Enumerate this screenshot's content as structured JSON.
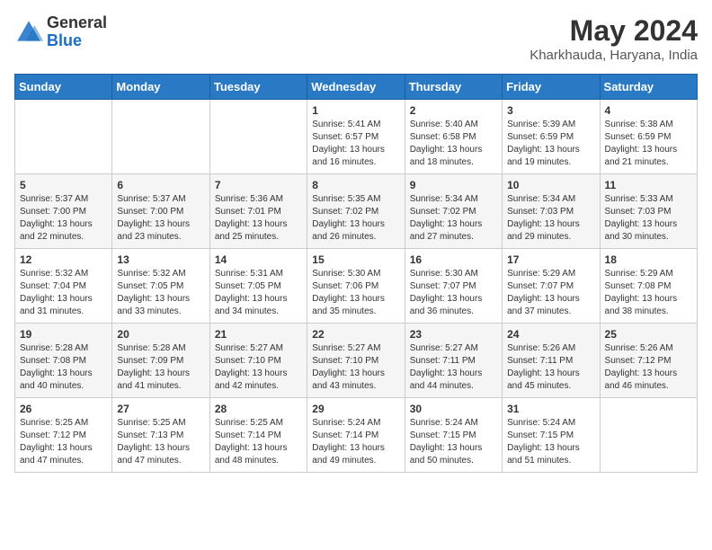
{
  "header": {
    "logo_general": "General",
    "logo_blue": "Blue",
    "month_year": "May 2024",
    "location": "Kharkhauda, Haryana, India"
  },
  "days_of_week": [
    "Sunday",
    "Monday",
    "Tuesday",
    "Wednesday",
    "Thursday",
    "Friday",
    "Saturday"
  ],
  "weeks": [
    [
      {
        "num": "",
        "info": ""
      },
      {
        "num": "",
        "info": ""
      },
      {
        "num": "",
        "info": ""
      },
      {
        "num": "1",
        "info": "Sunrise: 5:41 AM\nSunset: 6:57 PM\nDaylight: 13 hours and 16 minutes."
      },
      {
        "num": "2",
        "info": "Sunrise: 5:40 AM\nSunset: 6:58 PM\nDaylight: 13 hours and 18 minutes."
      },
      {
        "num": "3",
        "info": "Sunrise: 5:39 AM\nSunset: 6:59 PM\nDaylight: 13 hours and 19 minutes."
      },
      {
        "num": "4",
        "info": "Sunrise: 5:38 AM\nSunset: 6:59 PM\nDaylight: 13 hours and 21 minutes."
      }
    ],
    [
      {
        "num": "5",
        "info": "Sunrise: 5:37 AM\nSunset: 7:00 PM\nDaylight: 13 hours and 22 minutes."
      },
      {
        "num": "6",
        "info": "Sunrise: 5:37 AM\nSunset: 7:00 PM\nDaylight: 13 hours and 23 minutes."
      },
      {
        "num": "7",
        "info": "Sunrise: 5:36 AM\nSunset: 7:01 PM\nDaylight: 13 hours and 25 minutes."
      },
      {
        "num": "8",
        "info": "Sunrise: 5:35 AM\nSunset: 7:02 PM\nDaylight: 13 hours and 26 minutes."
      },
      {
        "num": "9",
        "info": "Sunrise: 5:34 AM\nSunset: 7:02 PM\nDaylight: 13 hours and 27 minutes."
      },
      {
        "num": "10",
        "info": "Sunrise: 5:34 AM\nSunset: 7:03 PM\nDaylight: 13 hours and 29 minutes."
      },
      {
        "num": "11",
        "info": "Sunrise: 5:33 AM\nSunset: 7:03 PM\nDaylight: 13 hours and 30 minutes."
      }
    ],
    [
      {
        "num": "12",
        "info": "Sunrise: 5:32 AM\nSunset: 7:04 PM\nDaylight: 13 hours and 31 minutes."
      },
      {
        "num": "13",
        "info": "Sunrise: 5:32 AM\nSunset: 7:05 PM\nDaylight: 13 hours and 33 minutes."
      },
      {
        "num": "14",
        "info": "Sunrise: 5:31 AM\nSunset: 7:05 PM\nDaylight: 13 hours and 34 minutes."
      },
      {
        "num": "15",
        "info": "Sunrise: 5:30 AM\nSunset: 7:06 PM\nDaylight: 13 hours and 35 minutes."
      },
      {
        "num": "16",
        "info": "Sunrise: 5:30 AM\nSunset: 7:07 PM\nDaylight: 13 hours and 36 minutes."
      },
      {
        "num": "17",
        "info": "Sunrise: 5:29 AM\nSunset: 7:07 PM\nDaylight: 13 hours and 37 minutes."
      },
      {
        "num": "18",
        "info": "Sunrise: 5:29 AM\nSunset: 7:08 PM\nDaylight: 13 hours and 38 minutes."
      }
    ],
    [
      {
        "num": "19",
        "info": "Sunrise: 5:28 AM\nSunset: 7:08 PM\nDaylight: 13 hours and 40 minutes."
      },
      {
        "num": "20",
        "info": "Sunrise: 5:28 AM\nSunset: 7:09 PM\nDaylight: 13 hours and 41 minutes."
      },
      {
        "num": "21",
        "info": "Sunrise: 5:27 AM\nSunset: 7:10 PM\nDaylight: 13 hours and 42 minutes."
      },
      {
        "num": "22",
        "info": "Sunrise: 5:27 AM\nSunset: 7:10 PM\nDaylight: 13 hours and 43 minutes."
      },
      {
        "num": "23",
        "info": "Sunrise: 5:27 AM\nSunset: 7:11 PM\nDaylight: 13 hours and 44 minutes."
      },
      {
        "num": "24",
        "info": "Sunrise: 5:26 AM\nSunset: 7:11 PM\nDaylight: 13 hours and 45 minutes."
      },
      {
        "num": "25",
        "info": "Sunrise: 5:26 AM\nSunset: 7:12 PM\nDaylight: 13 hours and 46 minutes."
      }
    ],
    [
      {
        "num": "26",
        "info": "Sunrise: 5:25 AM\nSunset: 7:12 PM\nDaylight: 13 hours and 47 minutes."
      },
      {
        "num": "27",
        "info": "Sunrise: 5:25 AM\nSunset: 7:13 PM\nDaylight: 13 hours and 47 minutes."
      },
      {
        "num": "28",
        "info": "Sunrise: 5:25 AM\nSunset: 7:14 PM\nDaylight: 13 hours and 48 minutes."
      },
      {
        "num": "29",
        "info": "Sunrise: 5:24 AM\nSunset: 7:14 PM\nDaylight: 13 hours and 49 minutes."
      },
      {
        "num": "30",
        "info": "Sunrise: 5:24 AM\nSunset: 7:15 PM\nDaylight: 13 hours and 50 minutes."
      },
      {
        "num": "31",
        "info": "Sunrise: 5:24 AM\nSunset: 7:15 PM\nDaylight: 13 hours and 51 minutes."
      },
      {
        "num": "",
        "info": ""
      }
    ]
  ]
}
